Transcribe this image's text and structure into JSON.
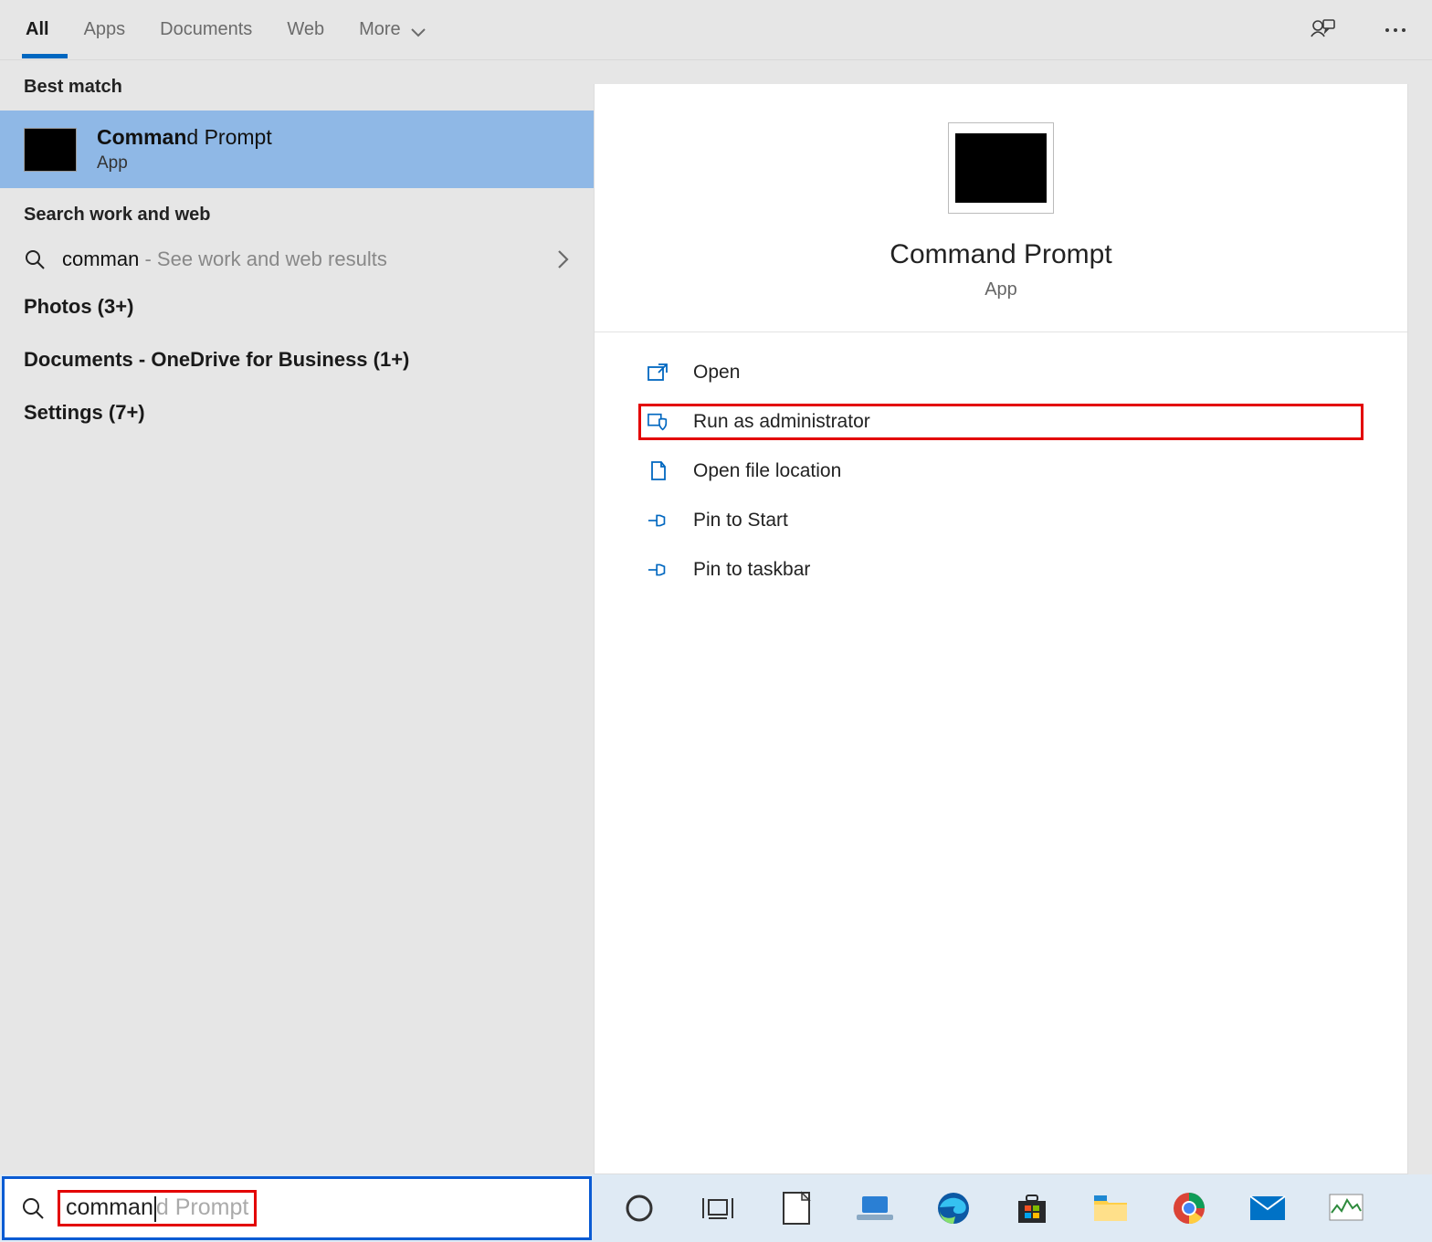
{
  "tabs": {
    "items": [
      "All",
      "Apps",
      "Documents",
      "Web",
      "More"
    ],
    "active_index": 0
  },
  "left": {
    "best_match_label": "Best match",
    "best_match": {
      "title_bold": "Comman",
      "title_rest": "d Prompt",
      "subtitle": "App"
    },
    "search_web_label": "Search work and web",
    "search_web": {
      "query": "comman",
      "hint": " - See work and web results"
    },
    "categories": [
      "Photos (3+)",
      "Documents - OneDrive for Business (1+)",
      "Settings (7+)"
    ]
  },
  "preview": {
    "title": "Command Prompt",
    "subtitle": "App",
    "actions": [
      {
        "label": "Open",
        "icon": "open"
      },
      {
        "label": "Run as administrator",
        "icon": "admin",
        "highlight": true
      },
      {
        "label": "Open file location",
        "icon": "location"
      },
      {
        "label": "Pin to Start",
        "icon": "pin"
      },
      {
        "label": "Pin to taskbar",
        "icon": "pin"
      }
    ]
  },
  "searchbox": {
    "typed": "comman",
    "ghost": "d Prompt"
  },
  "taskbar_apps": [
    "cortana",
    "task-view",
    "notepad",
    "laptop",
    "edge",
    "store",
    "explorer",
    "chrome",
    "mail",
    "perf"
  ]
}
